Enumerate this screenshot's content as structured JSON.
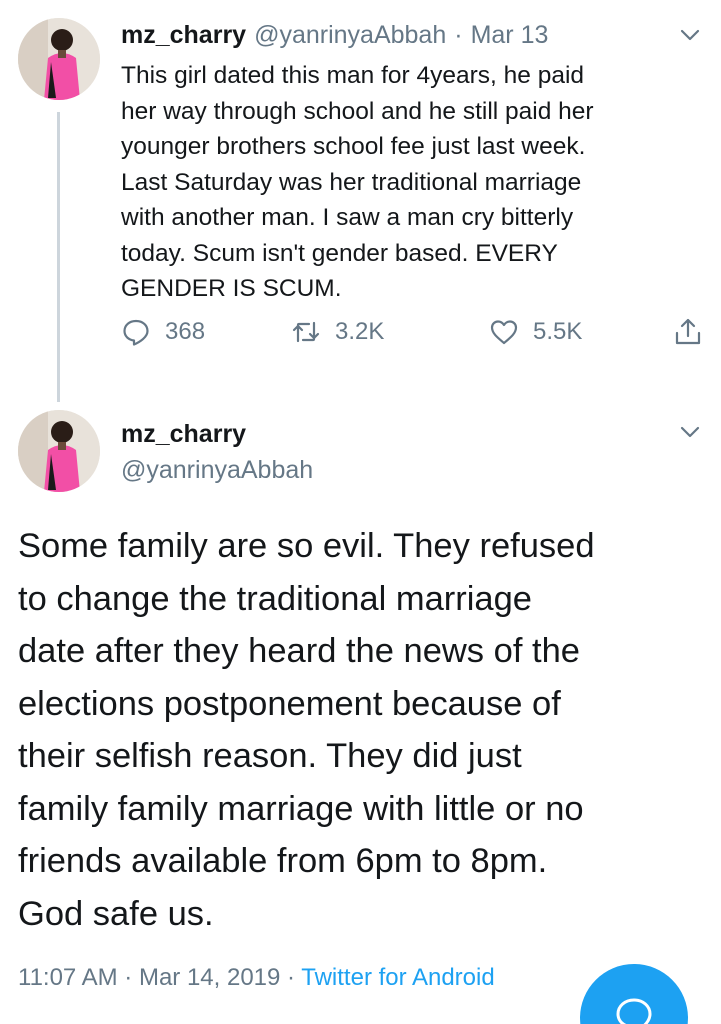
{
  "reply_context_tweet": {
    "display_name": "mz_charry",
    "handle": "@yanrinyaAbbah",
    "separator": "·",
    "date": "Mar 13",
    "text_lines": [
      "This girl dated this man for 4years, he paid",
      "her way through school and he still paid her",
      "younger brothers school fee just last week.",
      "Last Saturday was her traditional marriage",
      "with another man. I saw a man cry bitterly",
      "today. Scum isn't gender based. EVERY",
      "GENDER IS SCUM."
    ],
    "reply_count": "368",
    "retweet_count": "3.2K",
    "like_count": "5.5K"
  },
  "main_tweet": {
    "display_name": "mz_charry",
    "handle": "@yanrinyaAbbah",
    "text_lines": [
      "Some family are so evil. They refused",
      "to change the traditional marriage",
      "date after they heard the news of the",
      "elections postponement because of",
      "their selfish reason. They did just",
      "family family marriage with little or no",
      "friends available from 6pm to 8pm.",
      "God safe us."
    ],
    "timestamp": "11:07 AM · Mar 14, 2019 · ",
    "source": "Twitter for Android"
  },
  "icons": {
    "more": "chevron-down-icon",
    "reply": "reply-icon",
    "retweet": "retweet-icon",
    "like": "heart-icon",
    "share": "share-icon",
    "compose": "compose-reply-icon"
  },
  "colors": {
    "brand": "#1da1f2",
    "secondary_text": "#657786",
    "primary_text": "#14171a",
    "thread_line": "#cdd5dc"
  }
}
